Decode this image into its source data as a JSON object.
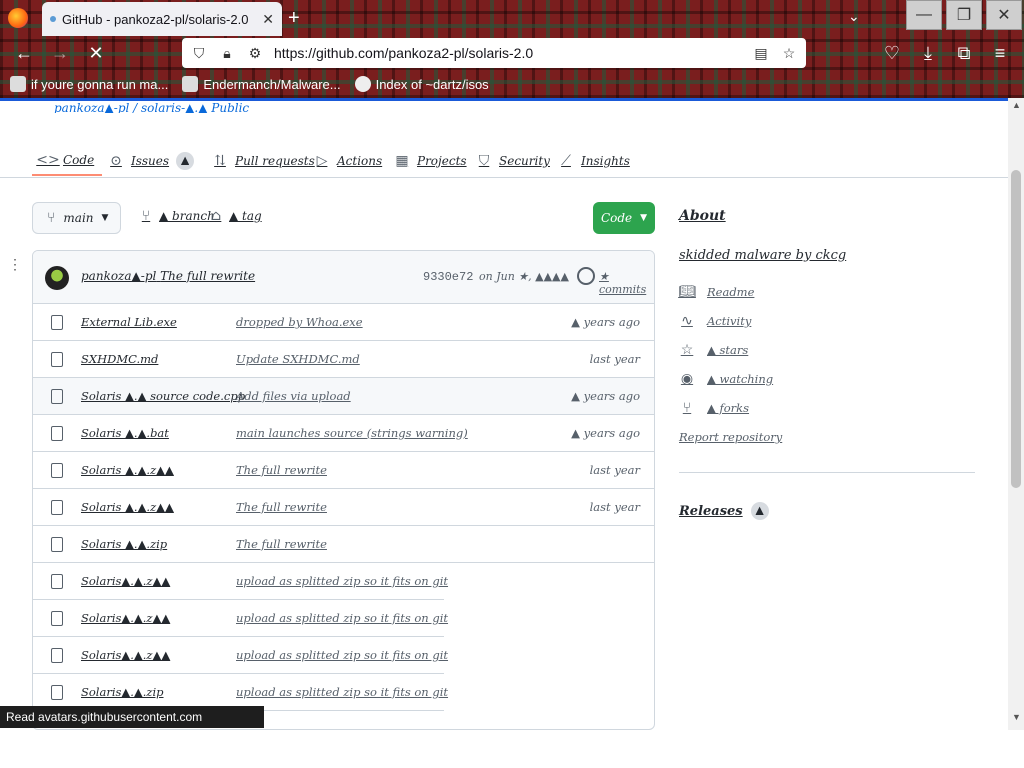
{
  "browser": {
    "tab_title": "GitHub - pankoza2-pl/solaris-2.0",
    "url": "https://github.com/pankoza2-pl/solaris-2.0",
    "bookmarks": [
      {
        "label": "if youre gonna run ma..."
      },
      {
        "label": "Endermanch/Malware..."
      },
      {
        "label": "Index of ~dartz/isos"
      }
    ],
    "status_text": "Read avatars.githubusercontent.com"
  },
  "repo_nav": {
    "items": [
      {
        "label": "Code",
        "icon": "code-icon"
      },
      {
        "label": "Issues",
        "icon": "issue-icon",
        "count": "▲"
      },
      {
        "label": "Pull requests",
        "icon": "pull-request-icon"
      },
      {
        "label": "Actions",
        "icon": "play-icon"
      },
      {
        "label": "Projects",
        "icon": "table-icon"
      },
      {
        "label": "Security",
        "icon": "shield-icon"
      },
      {
        "label": "Insights",
        "icon": "graph-icon"
      }
    ]
  },
  "toolbar": {
    "branch_label": "main",
    "branches_label": "▲ branch",
    "tags_label": "▲ tag",
    "code_button": "Code"
  },
  "commit": {
    "author": "pankoza▲-pl",
    "message": "The full rewrite",
    "hash": "9330e72",
    "date": "on Jun ★, ▲▲▲▲",
    "commits_label": "★ commits"
  },
  "files": [
    {
      "name": "External Lib.exe",
      "message": "dropped by Whoa.exe",
      "age": "▲ years ago"
    },
    {
      "name": "SXHDMC.md",
      "message": "Update SXHDMC.md",
      "age": "last year"
    },
    {
      "name": "Solaris ▲.▲ source code.cpp",
      "message": "Add files via upload",
      "age": "▲ years ago"
    },
    {
      "name": "Solaris ▲.▲.bat",
      "message": "main launches source (strings warning)",
      "age": "▲ years ago"
    },
    {
      "name": "Solaris ▲.▲.z▲▲",
      "message": "The full rewrite",
      "age": "last year"
    },
    {
      "name": "Solaris ▲.▲.z▲▲",
      "message": "The full rewrite",
      "age": "last year"
    },
    {
      "name": "Solaris ▲.▲.zip",
      "message": "The full rewrite",
      "age": ""
    },
    {
      "name": "Solaris▲.▲.z▲▲",
      "message": "upload as splitted zip so it fits on git",
      "age": ""
    },
    {
      "name": "Solaris▲.▲.z▲▲",
      "message": "upload as splitted zip so it fits on git",
      "age": ""
    },
    {
      "name": "Solaris▲.▲.z▲▲",
      "message": "upload as splitted zip so it fits on git",
      "age": ""
    },
    {
      "name": "Solaris▲.▲.zip",
      "message": "upload as splitted zip so it fits on git",
      "age": ""
    }
  ],
  "about": {
    "heading": "About",
    "description": "skidded malware by ckcg",
    "items": [
      {
        "label": "Readme",
        "icon": "book-icon"
      },
      {
        "label": "Activity",
        "icon": "pulse-icon"
      },
      {
        "label": "▲ stars",
        "icon": "star-icon"
      },
      {
        "label": "▲ watching",
        "icon": "eye-icon"
      },
      {
        "label": "▲ forks",
        "icon": "fork-icon"
      }
    ],
    "report": "Report repository",
    "releases": "Releases",
    "releases_count": "▲"
  },
  "header_strip": "pankoza▲-pl / solaris-▲.▲  Public"
}
